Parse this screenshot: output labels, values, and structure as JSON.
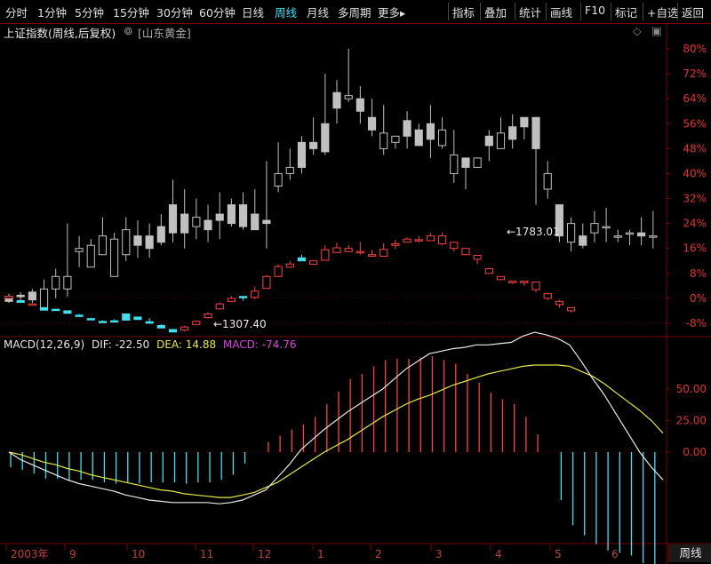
{
  "toolbar": {
    "periods": [
      "分时",
      "1分钟",
      "5分钟",
      "15分钟",
      "30分钟",
      "60分钟",
      "日线",
      "周线",
      "月线",
      "多周期",
      "更多▸"
    ],
    "active_index": 7,
    "tools": [
      "指标",
      "叠加",
      "统计",
      "画线",
      "F10",
      "标记",
      "+自选",
      "返回"
    ]
  },
  "title": {
    "index_name": "上证指数(周线,后复权)",
    "overlay_name": "[山东黄金]"
  },
  "colors": {
    "up": "#ff4040",
    "down": "#40e0f0",
    "gray": "#c0c0c0",
    "dif": "#e8e8e8",
    "dea": "#e8e840",
    "macd": "#e040e0",
    "grid": "#7a0000"
  },
  "macd": {
    "label": "MACD(12,26,9)",
    "dif_label": "DIF: -22.50",
    "dea_label": "DEA: 14.88",
    "macd_label": "MACD: -74.76"
  },
  "period_tag": "周线",
  "chart_data": [
    {
      "type": "candlestick",
      "title": "",
      "y_axis_labels": [
        "80%",
        "72%",
        "64%",
        "56%",
        "48%",
        "40%",
        "32%",
        "24%",
        "16%",
        "8%",
        "0%",
        "-8%"
      ],
      "ylim": [
        -12,
        82
      ],
      "annotations": [
        {
          "text": "←1307.40",
          "series": "上证指数"
        },
        {
          "text": "←1783.01",
          "series": "上证指数"
        }
      ],
      "series": [
        {
          "name": "山东黄金",
          "candles": [
            [
              0,
              0.5,
              -1,
              -1.5,
              1.5
            ],
            [
              -1,
              1,
              0.5,
              -0.5,
              2
            ],
            [
              0,
              2,
              -0.5,
              -1.5,
              3
            ],
            [
              1,
              -3,
              3,
              0.5,
              6
            ],
            [
              -2,
              3,
              7,
              0,
              9.5
            ],
            [
              8,
              3,
              7,
              0.5,
              24
            ],
            [
              12,
              15,
              16,
              10,
              20
            ],
            [
              10,
              10,
              17,
              15,
              19
            ],
            [
              10,
              14,
              20,
              15,
              26
            ],
            [
              10,
              7,
              19,
              14,
              21
            ],
            [
              12,
              14,
              22,
              12,
              26
            ],
            [
              18,
              20,
              17,
              13,
              25
            ],
            [
              15,
              20,
              16,
              13,
              24
            ],
            [
              18,
              23,
              18,
              17,
              27
            ],
            [
              22,
              30,
              21,
              18,
              38
            ],
            [
              18,
              27,
              21,
              16,
              35
            ],
            [
              26,
              23,
              26,
              19,
              32
            ],
            [
              22,
              25,
              22,
              18,
              30
            ],
            [
              22,
              27,
              25,
              19,
              34
            ],
            [
              25,
              30,
              24,
              23,
              32
            ],
            [
              29,
              30,
              23,
              22,
              34
            ],
            [
              30,
              27,
              22,
              22,
              35
            ],
            [
              20,
              25,
              24,
              16,
              44
            ],
            [
              22,
              36,
              40,
              34,
              50
            ],
            [
              40,
              40,
              42,
              38,
              48
            ],
            [
              42,
              50,
              42,
              40,
              52
            ],
            [
              50,
              50,
              48,
              46,
              58
            ],
            [
              46,
              56,
              47,
              46,
              72
            ],
            [
              46,
              66,
              61,
              56,
              70
            ],
            [
              58,
              64,
              65,
              63,
              80
            ],
            [
              60,
              64,
              60,
              56,
              68
            ],
            [
              58,
              58,
              54,
              52,
              64
            ],
            [
              60,
              48,
              53,
              46,
              62
            ],
            [
              60,
              50,
              52,
              48,
              52
            ],
            [
              58,
              57,
              52,
              48,
              60
            ],
            [
              54,
              54,
              49,
              49,
              56
            ],
            [
              56,
              56,
              51,
              45,
              62
            ],
            [
              55,
              49,
              54,
              48,
              58
            ],
            [
              48,
              40,
              46,
              37,
              54
            ],
            [
              44,
              45,
              42,
              35,
              44
            ],
            [
              45,
              42,
              45,
              42,
              44
            ],
            [
              42,
              52,
              49,
              44,
              54
            ],
            [
              46,
              48,
              53,
              48,
              58
            ],
            [
              48,
              55,
              51,
              48,
              59
            ],
            [
              46,
              58,
              55,
              51,
              56
            ],
            [
              60,
              58,
              48,
              30,
              56
            ],
            [
              42,
              35,
              40,
              32,
              44
            ],
            [
              30,
              30,
              20,
              18,
              30
            ],
            [
              18,
              18,
              24,
              15,
              26
            ],
            [
              14,
              20,
              17,
              16,
              24
            ],
            [
              18,
              21,
              24,
              18,
              28
            ],
            [
              18,
              23,
              23,
              18,
              29
            ],
            [
              22,
              20,
              20,
              18,
              22
            ],
            [
              22,
              21,
              21,
              17,
              22
            ],
            [
              26,
              21,
              20,
              17,
              26
            ],
            [
              20,
              20,
              20,
              16,
              28
            ]
          ]
        },
        {
          "name": "上证指数",
          "candles": [
            [
              0.4,
              0,
              0.7,
              0.5,
              0.6
            ],
            [
              0,
              -0.7,
              -1.3,
              -0.8,
              -1.1
            ],
            [
              -1,
              -1.8,
              -1.8,
              -1.8,
              -1.7
            ],
            [
              -2.7,
              -3,
              -3.8,
              -3,
              -3
            ],
            [
              -3,
              -3.5,
              -3.8,
              -3.5,
              -3.5
            ],
            [
              -4,
              -4,
              -4.8,
              -4,
              -4
            ],
            [
              -5,
              -5.4,
              -5.8,
              -5,
              -5.4
            ],
            [
              -6,
              -6.5,
              -6.6,
              -6.2,
              -6.3
            ],
            [
              -6.4,
              -7.4,
              -7.5,
              -7,
              -7.2
            ],
            [
              -6.4,
              -7.2,
              -7.5,
              -6.7,
              -7
            ],
            [
              -4,
              -5,
              -7,
              -5,
              -5.2
            ],
            [
              -4.5,
              -6,
              -6.8,
              -5.9,
              -6.4
            ],
            [
              -6.3,
              -7.5,
              -8,
              -6.3,
              -7.5
            ],
            [
              -8.2,
              -8.7,
              -9.5,
              -8.4,
              -8.5
            ],
            [
              -10,
              -10,
              -10.8,
              -10,
              -10
            ],
            [
              -10.7,
              -10.2,
              -9.2,
              -8.8,
              -10.6
            ],
            [
              -8.9,
              -8.4,
              -7.4,
              -7,
              -8.5
            ],
            [
              -6.8,
              -6.2,
              -5,
              -4.4,
              -6.4
            ],
            [
              -3.8,
              -3.4,
              -1.8,
              -1.3,
              -3.6
            ],
            [
              -1.5,
              -1,
              0,
              0.7,
              -1.2
            ],
            [
              -0.3,
              0.6,
              0.2,
              -0.8,
              -0.4
            ],
            [
              -0.3,
              0.3,
              2.3,
              3.8,
              -0.3
            ],
            [
              2.5,
              3.2,
              7,
              7.5,
              3
            ],
            [
              7.5,
              7,
              10.2,
              10.9,
              7.5
            ],
            [
              10.3,
              10,
              11,
              12,
              9.9
            ],
            [
              11,
              13,
              12,
              14,
              13
            ],
            [
              11,
              10.9,
              12,
              12,
              11.3
            ],
            [
              12.6,
              12.2,
              15.6,
              17,
              12.3
            ],
            [
              15.5,
              14.7,
              16.2,
              17.8,
              15.4
            ],
            [
              16,
              15,
              16,
              17,
              15
            ],
            [
              15,
              15,
              15,
              18,
              14
            ],
            [
              13.8,
              13.5,
              14,
              15.5,
              13.5
            ],
            [
              14.4,
              13.5,
              15.7,
              17.7,
              14
            ],
            [
              15.5,
              17,
              17.5,
              18.8,
              15.8
            ],
            [
              18.5,
              18,
              19,
              19.5,
              18.7
            ],
            [
              19,
              18.5,
              18.8,
              20,
              18
            ],
            [
              19,
              18.5,
              20,
              21,
              19
            ],
            [
              19,
              17.5,
              20,
              21,
              17
            ],
            [
              18,
              16,
              18,
              18,
              15
            ],
            [
              16,
              14,
              16,
              16,
              14
            ],
            [
              13.8,
              12.5,
              13.8,
              13.3,
              11
            ],
            [
              10,
              8,
              9.5,
              9.5,
              8.5
            ],
            [
              8,
              6,
              7,
              7,
              6
            ],
            [
              6,
              5,
              5.5,
              5.5,
              4.6
            ],
            [
              5.5,
              5,
              5.5,
              5.5,
              4
            ],
            [
              5,
              2.8,
              5.2,
              4.9,
              2
            ],
            [
              2,
              0,
              1.5,
              1.5,
              -0.5
            ],
            [
              -0.4,
              -2,
              -1,
              -0.5,
              -3
            ],
            [
              -2,
              -4,
              -3,
              -3,
              -4.5
            ]
          ]
        }
      ]
    },
    {
      "type": "bar",
      "title": "MACD(12,26,9)",
      "y_axis_labels": [
        "50.00",
        "25.00",
        "0.00"
      ],
      "ylim": [
        -88,
        88
      ],
      "series": [
        {
          "name": "MACD",
          "values": [
            -12,
            -14,
            -17,
            -21,
            -21,
            -23,
            -22,
            -22,
            -24,
            -25,
            -24,
            -25,
            -24,
            -24,
            -24,
            -25,
            -24,
            -24,
            -22,
            -18,
            -9,
            0,
            8,
            13,
            18,
            22,
            28,
            38,
            48,
            58,
            62,
            68,
            73,
            74,
            74,
            75,
            76,
            73,
            70,
            62,
            55,
            47,
            42,
            38,
            28,
            14,
            0,
            -38,
            -58,
            -66,
            -73,
            -78,
            -80,
            -82,
            -88,
            -89
          ]
        },
        {
          "name": "DIF",
          "values": [
            0,
            -6,
            -10,
            -14,
            -18,
            -22,
            -25,
            -27,
            -29,
            -31,
            -34,
            -36,
            -38,
            -39,
            -40,
            -40,
            -40,
            -40,
            -41,
            -40,
            -38,
            -34,
            -30,
            -20,
            -10,
            2,
            10,
            18,
            25,
            32,
            38,
            44,
            50,
            58,
            66,
            72,
            78,
            80,
            82,
            83,
            85,
            85,
            86,
            87,
            92,
            95,
            93,
            90,
            85,
            72,
            58,
            45,
            30,
            15,
            0,
            -12,
            -22
          ]
        },
        {
          "name": "DEA",
          "values": [
            0,
            -2,
            -5,
            -8,
            -10,
            -13,
            -15,
            -18,
            -20,
            -22,
            -24,
            -26,
            -28,
            -30,
            -31,
            -33,
            -34,
            -35,
            -36,
            -36,
            -34,
            -32,
            -28,
            -24,
            -18,
            -12,
            -6,
            0,
            5,
            10,
            16,
            22,
            28,
            33,
            38,
            42,
            45,
            49,
            53,
            56,
            59,
            62,
            64,
            66,
            68,
            69,
            69,
            69,
            68,
            64,
            60,
            54,
            47,
            40,
            33,
            25,
            15
          ]
        }
      ]
    }
  ],
  "date_axis": [
    "2003年",
    "9",
    "10",
    "11",
    "12",
    "1",
    "2",
    "3",
    "4",
    "5",
    "6"
  ]
}
